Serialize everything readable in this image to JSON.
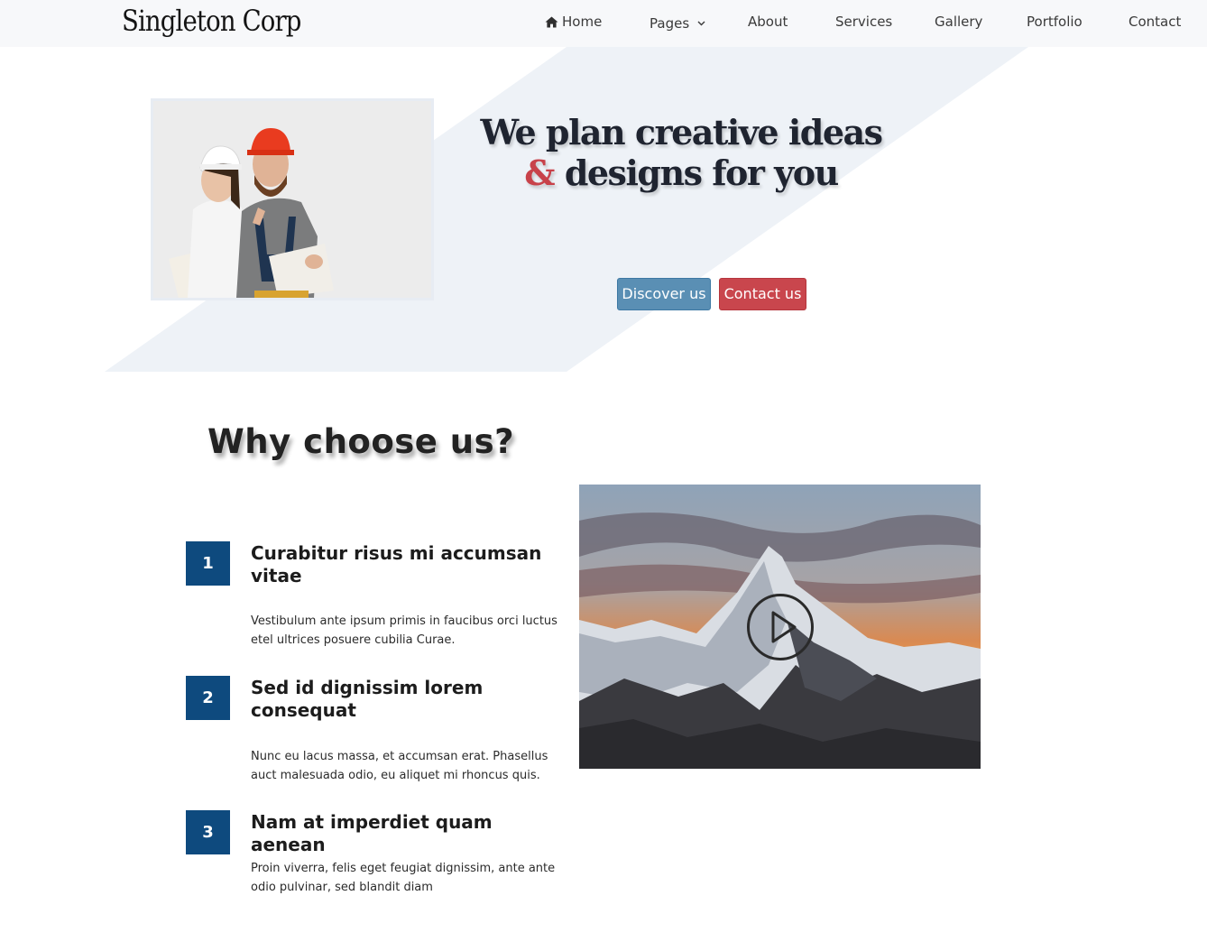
{
  "nav": {
    "brand": "Singleton Corp",
    "items": [
      {
        "label": "Home",
        "icon": "home-icon"
      },
      {
        "label": "Pages",
        "icon": "chevron-down-icon"
      },
      {
        "label": "About"
      },
      {
        "label": "Services"
      },
      {
        "label": "Gallery"
      },
      {
        "label": "Portfolio"
      },
      {
        "label": "Contact"
      }
    ]
  },
  "hero": {
    "title_line1": "We plan creative ideas",
    "title_amp": "&",
    "title_line2": "designs for you",
    "discover_label": "Discover us",
    "contact_label": "Contact us",
    "photo_subject": "two workers in hard hats holding blueprints"
  },
  "why": {
    "title": "Why choose us?",
    "features": [
      {
        "number": "1",
        "title": "Curabitur risus mi accumsan vitae",
        "text": "Vestibulum ante ipsum primis in faucibus orci luctus etel ultrices posuere cubilia Curae."
      },
      {
        "number": "2",
        "title": "Sed id dignissim lorem consequat",
        "text": "Nunc eu lacus massa, et accumsan erat. Phasellus auct malesuada odio, eu aliquet mi rhoncus quis."
      },
      {
        "number": "3",
        "title": "Nam at imperdiet quam aenean",
        "text": "Proin viverra, felis eget feugiat dignissim, ante ante odio pulvinar, sed blandit diam"
      }
    ],
    "video_subject": "snowy mountain peak at sunset",
    "play_icon": "play-icon"
  },
  "colors": {
    "accent_red": "#c8424a",
    "button_blue": "#5a8fb4",
    "number_navy": "#0e4a7e",
    "navbar_bg": "#f7f8fa",
    "hero_band": "#eef2f7"
  }
}
